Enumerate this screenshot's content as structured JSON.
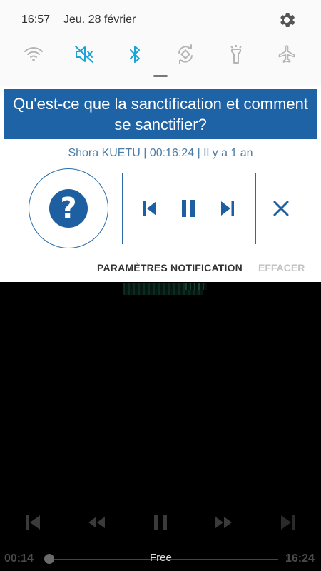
{
  "status": {
    "time": "16:57",
    "date": "Jeu. 28 février"
  },
  "quick_settings": [
    {
      "name": "wifi-icon",
      "active": false
    },
    {
      "name": "sound-mute-icon",
      "active": true
    },
    {
      "name": "bluetooth-icon",
      "active": true
    },
    {
      "name": "auto-rotate-icon",
      "active": false
    },
    {
      "name": "flashlight-icon",
      "active": false
    },
    {
      "name": "airplane-mode-icon",
      "active": false
    }
  ],
  "media_notification": {
    "title": "Qu'est-ce que la sanctification et comment se sanctifier?",
    "meta": "Shora KUETU | 00:16:24 | Il y a 1 an",
    "art_icon": "question-mark-icon",
    "art_glyph": "?",
    "controls": [
      "previous-icon",
      "pause-icon",
      "next-icon",
      "close-icon"
    ]
  },
  "footer": {
    "notification_settings_label": "PARAMÈTRES NOTIFICATION",
    "clear_label": "EFFACER"
  },
  "player": {
    "current_time": "00:14",
    "total_time": "16:24",
    "quality_label": "Free",
    "progress_fraction": 0.014
  },
  "colors": {
    "accent_blue": "#1e63a6",
    "active_icon": "#1aa3d9",
    "inactive_icon": "#b5b5b5"
  }
}
